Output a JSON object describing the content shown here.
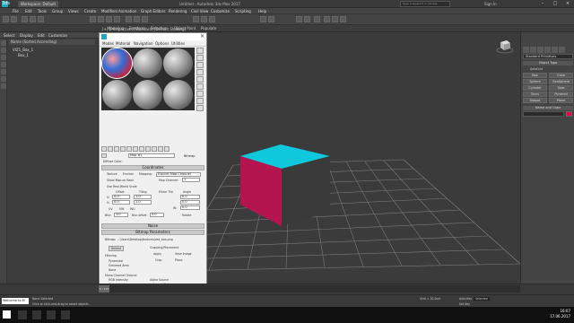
{
  "titlebar": {
    "workspace": "Workspace: Default",
    "title": "Untitled - Autodesk 3ds Max 2017",
    "search_placeholder": "Type a keyword or phrase",
    "signin": "Sign In"
  },
  "menubar": [
    "File",
    "Edit",
    "Tools",
    "Group",
    "Views",
    "Create",
    "Modifiers",
    "Animation",
    "Graph Editors",
    "Rendering",
    "Civil View",
    "Customize",
    "Scripting",
    "Help"
  ],
  "ribbon": [
    "Modeling",
    "Freeform",
    "Selection",
    "Object Paint",
    "Populate"
  ],
  "left_tabs": [
    "Select",
    "Display",
    "Edit",
    "Customize"
  ],
  "scene_explorer": {
    "header": "Name (Sorted Ascending)",
    "items": [
      "VIZ1_Box_1",
      "Box_1"
    ]
  },
  "workspace_label": "Workspace: Default",
  "viewport": {
    "label": "[+] [Perspective] [Standard] [Default Shading]"
  },
  "right_panel": {
    "object_type": "Object Type",
    "autogrid": "AutoGrid",
    "category": "Standard Primitives",
    "buttons": [
      "Box",
      "Cone",
      "Sphere",
      "GeoSphere",
      "Cylinder",
      "Tube",
      "Torus",
      "Pyramid",
      "Teapot",
      "Plane"
    ],
    "name_and_color": "Name and Color"
  },
  "material_editor": {
    "title_icon": "3ds",
    "menu": [
      "Modes",
      "Material",
      "Navigation",
      "Options",
      "Utilities"
    ],
    "mat_name": "Map #1",
    "map_type": "Bitmap",
    "diffuse": "Diffuse Color:",
    "coordinates_title": "Coordinates",
    "texture": "Texture",
    "environ": "Environ",
    "mapping_label": "Mapping:",
    "mapping_value": "Explicit Map Channel",
    "show_map": "Show Map on Back",
    "map_channel": "Map Channel:",
    "map_channel_value": "1",
    "real_world": "Use Real-World Scale",
    "offset": "Offset",
    "tiling": "Tiling",
    "mirror_tile": "Mirror Tile",
    "angle": "Angle",
    "u": "U:",
    "v": "V:",
    "w": "W:",
    "offset_u": "0.0",
    "offset_v": "0.0",
    "tiling_u": "1.0",
    "tiling_v": "1.0",
    "angle_u": "0.0",
    "angle_v": "0.0",
    "angle_w": "0.0",
    "uv": "UV",
    "vw": "VW",
    "wu": "WU",
    "blur": "Blur:",
    "blur_value": "1.0",
    "blur_offset": "Blur offset:",
    "blur_offset_value": "0.0",
    "rotate": "Rotate",
    "noise_title": "Noise",
    "bitmap_params_title": "Bitmap Parameters",
    "bitmap_path": "Bitmap: ...\\Users\\Desktop\\textures\\red_box.png",
    "reload": "Reload",
    "filtering": "Filtering",
    "pyramidal": "Pyramidal",
    "summed": "Summed Area",
    "none": "None",
    "cropping": "Cropping/Placement",
    "apply": "Apply",
    "view_image": "View Image",
    "crop": "Crop",
    "place": "Place",
    "mono": "Mono Channel Output:",
    "rgb_intensity": "RGB Intensity",
    "alpha": "Alpha",
    "rgb_out": "RGB Channel Output:",
    "rgb": "RGB",
    "alpha_source": "Alpha Source",
    "image_alpha": "Image Alpha",
    "rgb_int2": "RGB Intensity",
    "none_opaque": "None (Opaque)"
  },
  "timeline": {
    "frame": "0 / 100"
  },
  "status": {
    "welcome": "Welcome to M",
    "none_selected": "None Selected",
    "hint": "Click or click-and-drag to select objects",
    "selected": "Selected",
    "grid": "Grid = 10,0cm",
    "autokey": "Auto Key",
    "setkey": "Set Key"
  },
  "taskbar": {
    "time": "16:07",
    "date": "17.06.2017"
  },
  "colors": {
    "cube_top": "#10c8dc",
    "cube_left": "#b5154f",
    "cube_right": "#3a3a3a",
    "grid": "#7a7a7a"
  }
}
